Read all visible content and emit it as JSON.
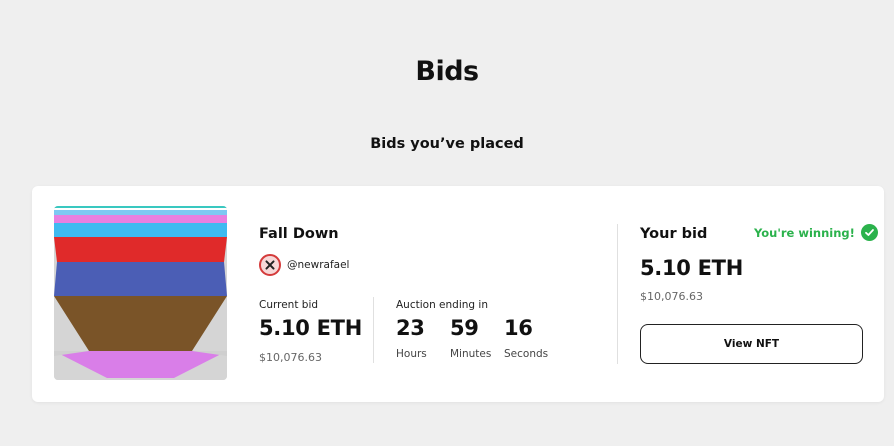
{
  "page": {
    "title": "Bids",
    "section_title": "Bids you’ve placed"
  },
  "bid_card": {
    "nft_name": "Fall Down",
    "owner_handle": "@newrafael",
    "owner_avatar_icon": "crossed-circle-icon",
    "current_bid": {
      "label": "Current bid",
      "value": "5.10 ETH",
      "usd": "$10,076.63"
    },
    "auction": {
      "label": "Auction ending in",
      "hours": "23",
      "hours_label": "Hours",
      "minutes": "59",
      "minutes_label": "Minutes",
      "seconds": "16",
      "seconds_label": "Seconds"
    },
    "your_bid": {
      "label": "Your bid",
      "status": "You're winning!",
      "status_icon": "check-circle-icon",
      "status_color": "#2bb24c",
      "value": "5.10 ETH",
      "usd": "$10,076.63"
    },
    "view_button_label": "View NFT"
  },
  "colors": {
    "background": "#efefef",
    "card": "#ffffff",
    "accent_green": "#2bb24c"
  }
}
